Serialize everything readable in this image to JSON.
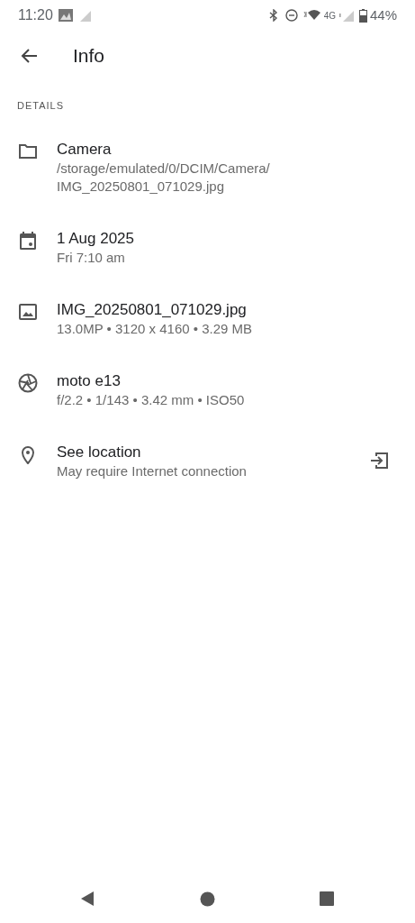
{
  "status_bar": {
    "time": "11:20",
    "network": "4G",
    "battery": "44%"
  },
  "toolbar": {
    "title": "Info"
  },
  "section": "DETAILS",
  "items": [
    {
      "kind": "folder",
      "title": "Camera",
      "subtitle": [
        "/storage/emulated/0/DCIM/Camera/",
        "IMG_20250801_071029.jpg"
      ]
    },
    {
      "kind": "date",
      "title": "1 Aug 2025",
      "subtitle": [
        "Fri 7:10 am"
      ]
    },
    {
      "kind": "image",
      "title": "IMG_20250801_071029.jpg",
      "subtitle": [
        "13.0MP • 3120 x 4160 • 3.29 MB"
      ]
    },
    {
      "kind": "camera",
      "title": "moto e13",
      "subtitle": [
        "f/2.2 • 1/143 • 3.42 mm • ISO50"
      ]
    },
    {
      "kind": "location",
      "title": "See location",
      "subtitle": [
        "May require Internet connection"
      ]
    }
  ]
}
